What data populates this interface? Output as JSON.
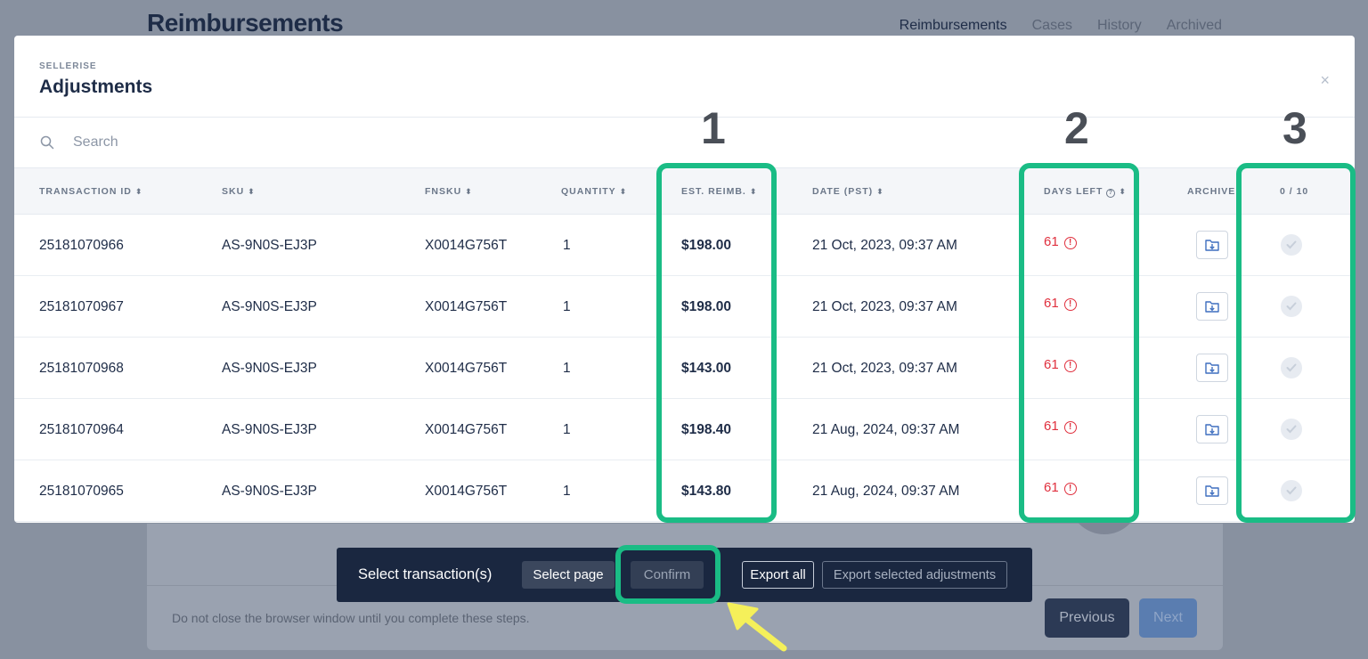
{
  "background": {
    "page_title": "Reimbursements",
    "nav": [
      "Reimbursements",
      "Cases",
      "History",
      "Archived"
    ],
    "footer_note": "Do not close the browser window until you complete these steps.",
    "previous_label": "Previous",
    "next_label": "Next"
  },
  "modal": {
    "brand": "SELLERISE",
    "title": "Adjustments",
    "close_label": "×",
    "search_placeholder": "Search",
    "columns": {
      "transaction_id": "TRANSACTION ID",
      "sku": "SKU",
      "fnsku": "FNSKU",
      "quantity": "QUANTITY",
      "est_reimb": "EST. REIMB.",
      "date": "DATE (PST)",
      "days_left": "DAYS LEFT",
      "archive": "ARCHIVE",
      "selected_count": "0 / 10"
    },
    "rows": [
      {
        "transaction_id": "25181070966",
        "sku": "AS-9N0S-EJ3P",
        "fnsku": "X0014G756T",
        "quantity": "1",
        "est_reimb": "$198.00",
        "date": "21 Oct, 2023, 09:37 AM",
        "days_left": "61"
      },
      {
        "transaction_id": "25181070967",
        "sku": "AS-9N0S-EJ3P",
        "fnsku": "X0014G756T",
        "quantity": "1",
        "est_reimb": "$198.00",
        "date": "21 Oct, 2023, 09:37 AM",
        "days_left": "61"
      },
      {
        "transaction_id": "25181070968",
        "sku": "AS-9N0S-EJ3P",
        "fnsku": "X0014G756T",
        "quantity": "1",
        "est_reimb": "$143.00",
        "date": "21 Oct, 2023, 09:37 AM",
        "days_left": "61"
      },
      {
        "transaction_id": "25181070964",
        "sku": "AS-9N0S-EJ3P",
        "fnsku": "X0014G756T",
        "quantity": "1",
        "est_reimb": "$198.40",
        "date": "21 Aug, 2024, 09:37 AM",
        "days_left": "61"
      },
      {
        "transaction_id": "25181070965",
        "sku": "AS-9N0S-EJ3P",
        "fnsku": "X0014G756T",
        "quantity": "1",
        "est_reimb": "$143.80",
        "date": "21 Aug, 2024, 09:37 AM",
        "days_left": "61"
      }
    ]
  },
  "action_bar": {
    "label": "Select transaction(s)",
    "select_page": "Select page",
    "confirm": "Confirm",
    "export_all": "Export all",
    "export_selected": "Export selected adjustments"
  },
  "annotations": {
    "numbers": [
      "1",
      "2",
      "3"
    ],
    "highlight_color": "#1abc85",
    "arrow_color": "#f5f05a"
  },
  "colors": {
    "days_left": "#e0303e",
    "navy": "#1e2c47"
  }
}
